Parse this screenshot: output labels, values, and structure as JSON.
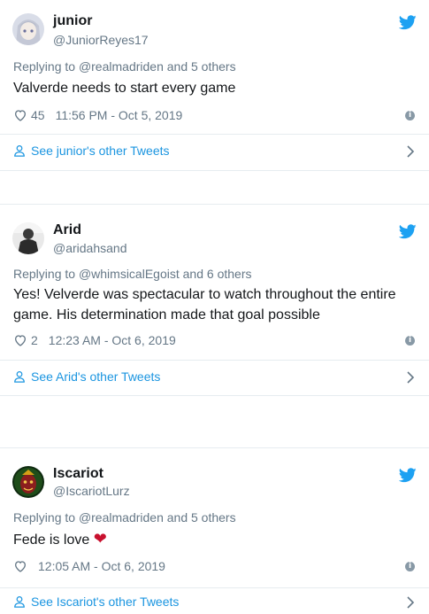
{
  "colors": {
    "link": "#1b95e0",
    "muted": "#657786",
    "text": "#14171a",
    "twitter": "#1da1f2",
    "heart_emoji": "#c8102e"
  },
  "tweets": [
    {
      "name": "junior",
      "handle": "@JuniorReyes17",
      "replying_prefix": "Replying to",
      "replying_to": "@realmadriden",
      "replying_suffix": "and 5 others",
      "text": "Valverde needs to start every game",
      "likes": "45",
      "timestamp": "11:56 PM - Oct 5, 2019",
      "see_more": "See junior's other Tweets"
    },
    {
      "name": "Arid",
      "handle": "@aridahsand",
      "replying_prefix": "Replying to",
      "replying_to": "@whimsicalEgoist",
      "replying_suffix": "and 6 others",
      "text": "Yes! Velverde was spectacular to watch throughout the entire game. His determination made that goal possible",
      "likes": "2",
      "timestamp": "12:23 AM - Oct 6, 2019",
      "see_more": "See Arid's other Tweets"
    },
    {
      "name": "Iscariot",
      "handle": "@IscariotLurz",
      "replying_prefix": "Replying to",
      "replying_to": "@realmadriden",
      "replying_suffix": "and 5 others",
      "text": "Fede is love",
      "emoji": "❤",
      "likes": "",
      "timestamp": "12:05 AM - Oct 6, 2019",
      "see_more": "See Iscariot's other Tweets"
    }
  ],
  "icons": {
    "bird": "twitter-bird-icon",
    "heart": "heart-icon",
    "info": "info-icon",
    "person": "person-icon",
    "chevron": "chevron-right-icon"
  }
}
